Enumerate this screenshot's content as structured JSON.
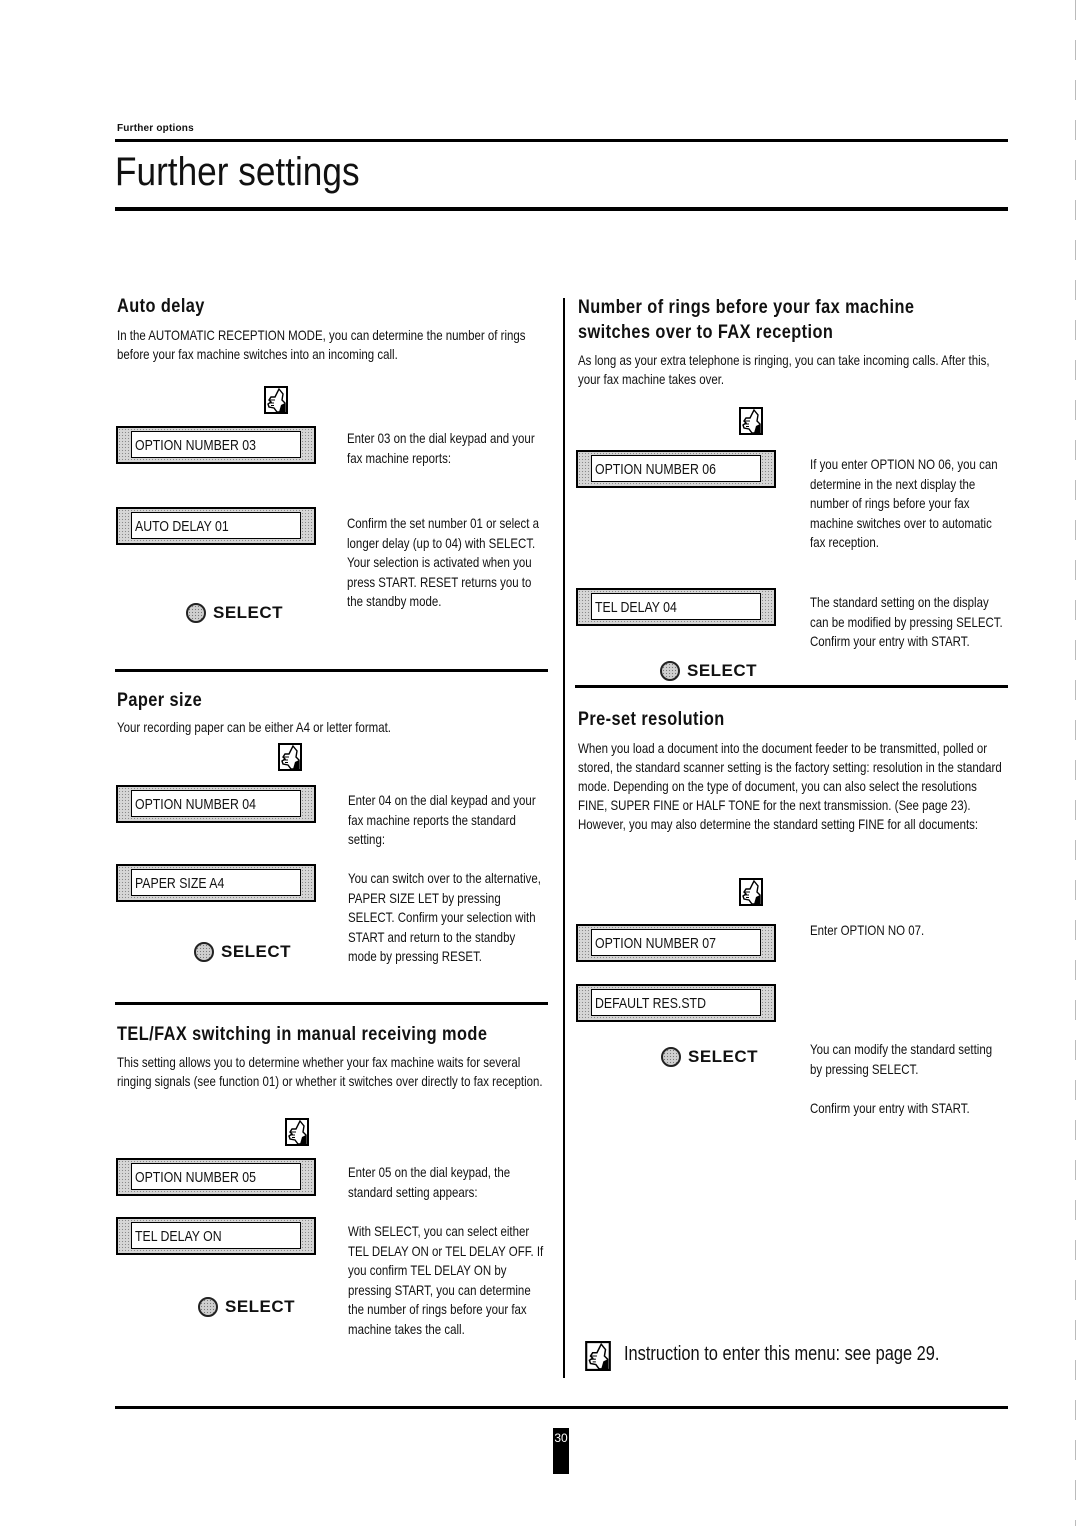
{
  "header": {
    "running_head": "Further options",
    "title": "Further settings"
  },
  "sections": {
    "auto_delay": {
      "heading": "Auto delay",
      "intro": "In the AUTOMATIC RECEPTION MODE, you can determine the number of rings before your fax machine switches into an incoming call.",
      "displays": [
        "OPTION NUMBER 03",
        "AUTO DELAY 01"
      ],
      "notes": [
        "Enter 03 on the dial keypad and your fax machine reports:",
        "Confirm the set number 01 or select a longer delay (up to 04) with SELECT. Your selection is activated when you press START.  RESET returns you to the standby mode."
      ],
      "select_label": "SELECT"
    },
    "paper_size": {
      "heading": "Paper size",
      "intro": "Your recording paper can be either A4 or letter format.",
      "displays": [
        "OPTION NUMBER 04",
        "PAPER SIZE A4"
      ],
      "notes": [
        "Enter 04 on the dial keypad and your fax machine reports the standard setting:",
        "You can switch over to the alternative, PAPER SIZE LET by pressing SELECT. Confirm your selection with START and return to the standby mode by pressing RESET."
      ],
      "select_label": "SELECT"
    },
    "tel_fax": {
      "heading": "TEL/FAX switching in manual receiving mode",
      "intro": "This setting allows you to determine whether your fax machine waits for several ringing signals (see function 01) or whether it switches over directly to fax reception.",
      "displays": [
        "OPTION NUMBER 05",
        "TEL DELAY ON"
      ],
      "notes": [
        "Enter 05 on the dial keypad, the standard setting appears:",
        "With SELECT, you can select either TEL DELAY ON or TEL DELAY OFF. If you confirm TEL DELAY ON by pressing START, you can determine the number of rings before your fax machine takes the call."
      ],
      "select_label": "SELECT"
    },
    "rings": {
      "heading_line1": "Number of rings before your fax machine",
      "heading_line2": "switches over to FAX reception",
      "intro": "As long as your extra telephone is ringing, you can take incoming calls. After this, your fax machine takes over.",
      "displays": [
        "OPTION NUMBER 06",
        "TEL DELAY 04"
      ],
      "notes": [
        "If you enter OPTION NO 06, you can determine in the next display the number of rings before your fax machine switches over to automatic fax reception.",
        "The standard setting on the display can be modified by pressing SELECT. Confirm your entry with START."
      ],
      "select_label": "SELECT"
    },
    "resolution": {
      "heading": "Pre-set resolution",
      "intro": "When you load a document into the document feeder to be transmitted, polled or stored, the standard scanner setting is the factory setting: resolution in the standard mode.  Depending on the type of document, you can also select the resolutions FINE, SUPER FINE or HALF TONE for the next transmission.  (See page 23). However, you may also determine the standard setting FINE for all documents:",
      "displays": [
        "OPTION NUMBER 07",
        "DEFAULT RES.STD"
      ],
      "notes": [
        "Enter OPTION NO 07.",
        "You can modify the standard setting by pressing SELECT.",
        "Confirm your entry with START."
      ],
      "select_label": "SELECT"
    }
  },
  "footer": {
    "instruction": "Instruction to enter this menu: see page 29.",
    "page_number": "30"
  },
  "icons": {
    "menu_hand": "hand-pointing-menu-icon",
    "select_button": "round-select-button-icon"
  }
}
